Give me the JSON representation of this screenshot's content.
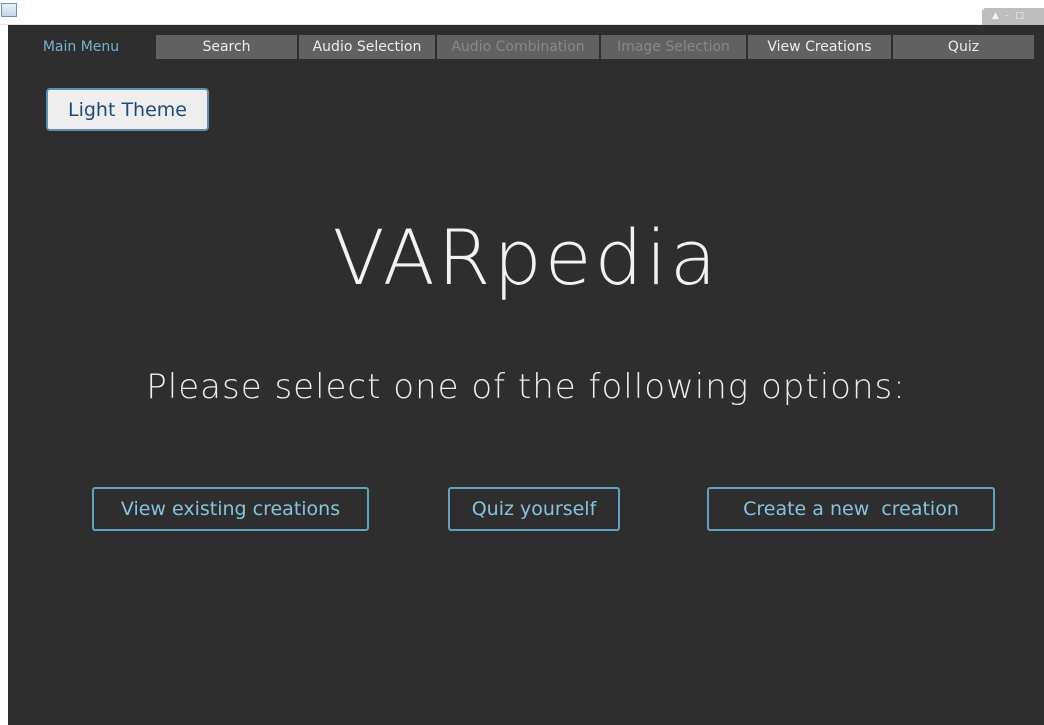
{
  "colors": {
    "background": "#2e2e2e",
    "accent": "#78b1cc",
    "tab_inactive": "#616161",
    "tab_disabled_text": "#888888",
    "button_border": "#5fa3c0"
  },
  "tabs": [
    {
      "label": "Main Menu",
      "state": "active"
    },
    {
      "label": "Search",
      "state": "normal"
    },
    {
      "label": "Audio Selection",
      "state": "normal"
    },
    {
      "label": "Audio Combination",
      "state": "disabled"
    },
    {
      "label": "Image Selection",
      "state": "disabled"
    },
    {
      "label": "View Creations",
      "state": "normal"
    },
    {
      "label": "Quiz",
      "state": "normal"
    }
  ],
  "theme_toggle": {
    "label": "Light Theme"
  },
  "main": {
    "title": "VARpedia",
    "subtitle": "Please select one of the following options:",
    "options": {
      "view": "View existing creations",
      "quiz": "Quiz yourself",
      "create": "Create a new  creation"
    }
  },
  "window_controls": {
    "icons": [
      "pin-icon",
      "minimize-icon",
      "maximize-icon"
    ]
  }
}
